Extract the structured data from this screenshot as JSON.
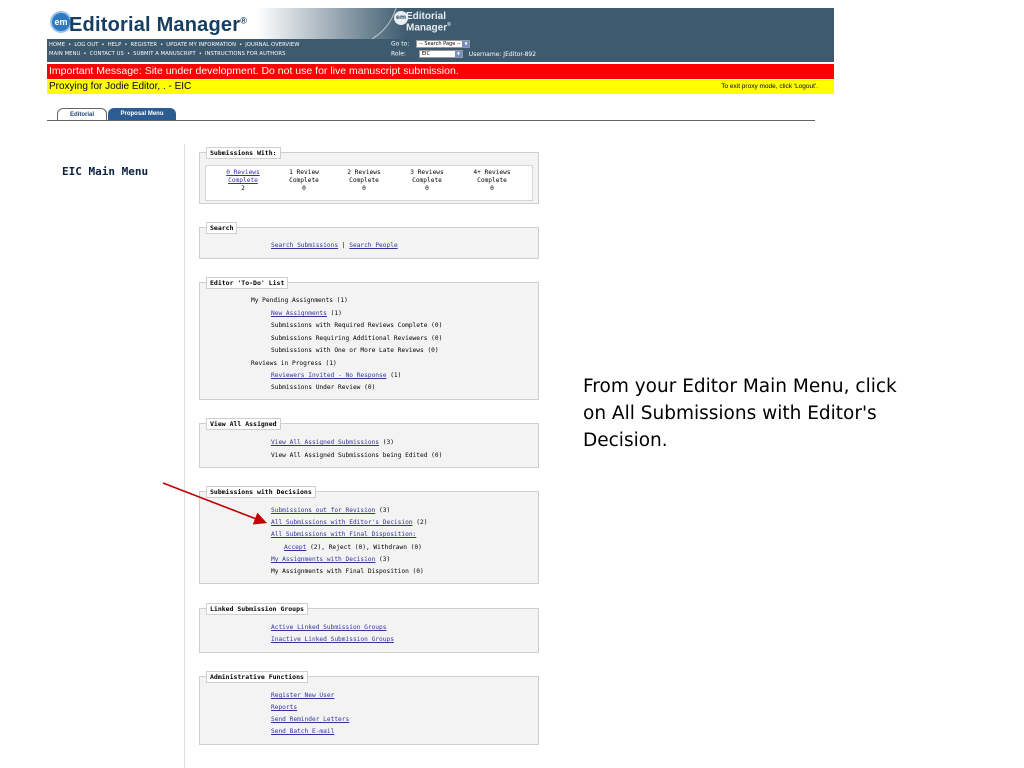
{
  "header": {
    "brand_logo": "em",
    "brand_name": "Editorial Manager",
    "brand_reg": "®",
    "nav_row1": [
      "HOME",
      "LOG OUT",
      "HELP",
      "REGISTER",
      "UPDATE MY INFORMATION",
      "JOURNAL OVERVIEW"
    ],
    "nav_row2": [
      "MAIN MENU",
      "CONTACT US",
      "SUBMIT A MANUSCRIPT",
      "INSTRUCTIONS FOR AUTHORS"
    ],
    "nav_sep": "•",
    "logo2_mark": "em",
    "logo2_line1": "Editorial",
    "logo2_line2": "Manager",
    "goto_label": "Go to:",
    "goto_value": "-- Search Page --",
    "role_label": "Role:",
    "role_value": "EIC",
    "username": "Username: JEditor-892"
  },
  "messages": {
    "important": "Important Message: Site under development. Do not use for live manuscript submission.",
    "proxy": "Proxying for Jodie Editor, . - EIC",
    "exit_proxy": "To exit proxy mode, click 'Logout'."
  },
  "tabs": [
    "Editorial",
    "Proposal Menu"
  ],
  "left_title": "EIC Main Menu",
  "submissions_with": {
    "title": "Submissions With:",
    "columns": [
      {
        "l1": "0 Reviews",
        "l2": "Complete",
        "count": "2",
        "link": true
      },
      {
        "l1": "1 Review",
        "l2": "Complete",
        "count": "0",
        "link": false
      },
      {
        "l1": "2 Reviews",
        "l2": "Complete",
        "count": "0",
        "link": false
      },
      {
        "l1": "3 Reviews",
        "l2": "Complete",
        "count": "0",
        "link": false
      },
      {
        "l1": "4+ Reviews",
        "l2": "Complete",
        "count": "0",
        "link": false
      }
    ]
  },
  "search": {
    "title": "Search",
    "link1": "Search Submissions",
    "sep": " | ",
    "link2": "Search People"
  },
  "todo": {
    "title": "Editor 'To-Do' List",
    "pending": "My Pending Assignments (1)",
    "new_assign": "New Assignments",
    "new_assign_count": " (1)",
    "req_complete": "Submissions with Required Reviews Complete (0)",
    "req_additional": "Submissions Requiring Additional Reviewers (0)",
    "late": "Submissions with One or More Late Reviews (0)",
    "in_progress": "Reviews in Progress (1)",
    "invited": "Reviewers Invited - No Response",
    "invited_count": " (1)",
    "under_review": "Submissions Under Review (0)"
  },
  "view_all": {
    "title": "View All Assigned",
    "link": "View All Assigned Submissions",
    "link_count": " (3)",
    "edited": "View All Assigned Submissions being Edited (0)"
  },
  "decisions": {
    "title": "Submissions with Decisions",
    "revision": "Submissions out for Revision",
    "revision_count": " (3)",
    "all_decision": "All Submissions with Editor's Decision",
    "all_decision_count": " (2)",
    "final_disp": "All Submissions with Final Disposition:",
    "accept": "Accept",
    "accept_rest": " (2), Reject (0), Withdrawn (0)",
    "my_decision": "My Assignments with Decision",
    "my_decision_count": " (3)",
    "my_final": "My Assignments with Final Disposition (0)"
  },
  "linked": {
    "title": "Linked Submission Groups",
    "active": "Active Linked Submission Groups",
    "inactive": "Inactive Linked Submission Groups"
  },
  "admin": {
    "title": "Administrative Functions",
    "items": [
      "Register New User",
      "Reports",
      "Send Reminder Letters",
      "Send Batch E-mail"
    ]
  },
  "annotation": "From your Editor Main Menu, click on All Submissions with Editor's Decision.",
  "colors": {
    "header_bg": "#3d5a6e",
    "important_bar": "#fe0000",
    "proxy_bar": "#ffff00",
    "link": "#33339a",
    "arrow": "#c00000"
  }
}
